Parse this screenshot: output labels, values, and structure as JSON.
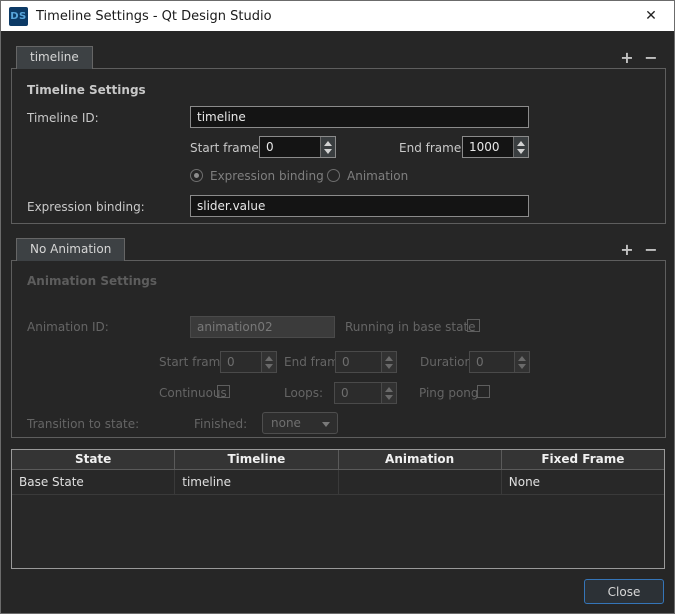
{
  "window": {
    "title": "Timeline Settings - Qt Design Studio",
    "icon_text": "DS",
    "close_glyph": "✕"
  },
  "timeline_section": {
    "tab_label": "timeline",
    "add_label": "+",
    "remove_label": "−",
    "heading": "Timeline Settings",
    "timeline_id_label": "Timeline ID:",
    "timeline_id_value": "timeline",
    "start_frame_label": "Start frame:",
    "start_frame_value": "0",
    "end_frame_label": "End frame:",
    "end_frame_value": "1000",
    "expression_binding_radio_label": "Expression binding",
    "animation_radio_label": "Animation",
    "expression_binding_label": "Expression binding:",
    "expression_binding_value": "slider.value"
  },
  "animation_section": {
    "tab_label": "No Animation",
    "add_label": "+",
    "remove_label": "−",
    "heading": "Animation Settings",
    "animation_id_label": "Animation ID:",
    "animation_id_value": "animation02",
    "running_in_base_state_label": "Running in base state",
    "start_frame_label": "Start frame:",
    "start_frame_value": "0",
    "end_frame_label": "End frame:",
    "end_frame_value": "0",
    "duration_label": "Duration:",
    "duration_value": "0",
    "continuous_label": "Continuous",
    "loops_label": "Loops:",
    "loops_value": "0",
    "ping_pong_label": "Ping pong",
    "transition_label": "Transition to state:",
    "finished_label": "Finished:",
    "finished_value": "none"
  },
  "states_table": {
    "headers": [
      "State",
      "Timeline",
      "Animation",
      "Fixed Frame"
    ],
    "rows": [
      [
        "Base State",
        "timeline",
        "",
        "None"
      ]
    ]
  },
  "footer": {
    "close_label": "Close"
  },
  "colors": {
    "titlebar_bg": "#ffffff",
    "dialog_bg": "#262626",
    "accent_blue": "#3575b8",
    "logo_bg": "#0c3a66",
    "logo_text": "#58a6dc"
  }
}
